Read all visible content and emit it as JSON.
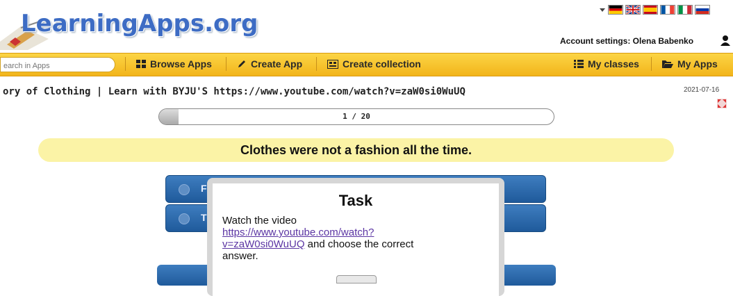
{
  "header": {
    "logo_text": "LearningApps.org",
    "account_label": "Account settings: Olena Babenko",
    "flags": [
      "de-flag",
      "uk-flag",
      "es-flag",
      "fr-flag",
      "it-flag",
      "ru-flag"
    ]
  },
  "nav": {
    "search_placeholder": "earch in Apps",
    "browse_apps": "Browse Apps",
    "create_app": "Create App",
    "create_collection": "Create collection",
    "my_classes": "My classes",
    "my_apps": "My Apps"
  },
  "app": {
    "title": "ory of Clothing | Learn with BYJU'S https://www.youtube.com/watch?v=zaW0si0WuUQ",
    "date": "2021-07-16"
  },
  "progress": {
    "text": "1 / 20",
    "current": 1,
    "total": 20
  },
  "question": "Clothes were not a fashion all the time.",
  "answers": [
    {
      "letter": "F"
    },
    {
      "letter": "T"
    }
  ],
  "task": {
    "title": "Task",
    "line1": "Watch the video",
    "link": "https://www.youtube.com/watch?v=zaW0si0WuUQ",
    "link_line1": "https://www.youtube.com/watch?",
    "link_line2": "v=zaW0si0WuUQ",
    "after_link": " and choose the correct",
    "line_last": "answer."
  },
  "colors": {
    "nav_bar": "#f7c52c",
    "question_bg": "#fbf3a6",
    "answer_bg": "#2b69aa",
    "logo": "#3d6cc4",
    "link": "#5b35a3"
  }
}
